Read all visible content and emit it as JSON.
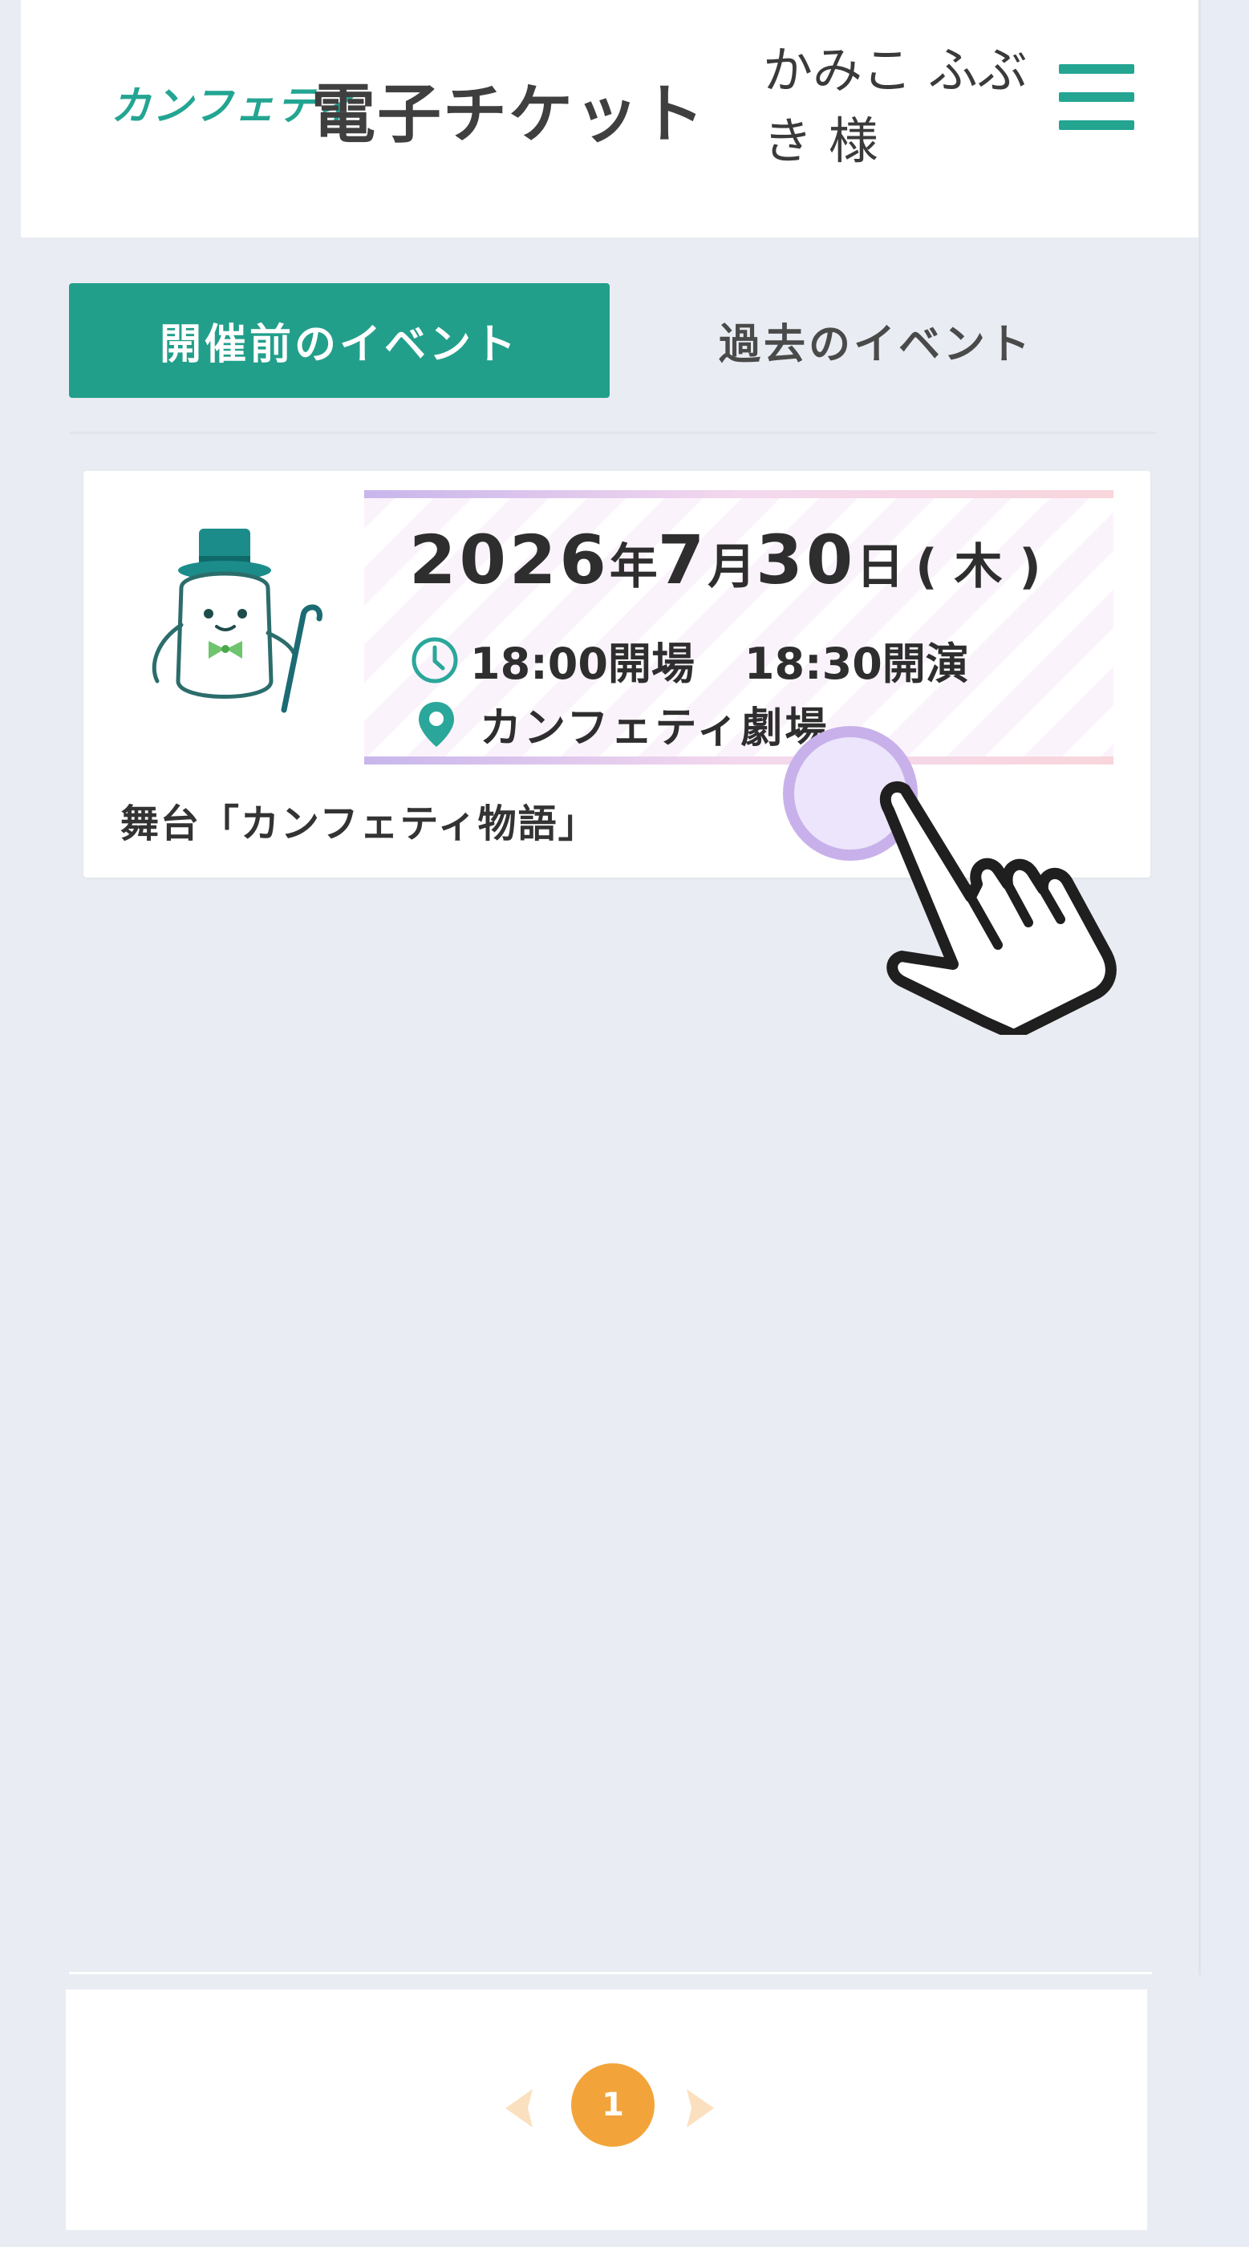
{
  "header": {
    "brand_small": "カンフェティ",
    "brand_title": "電子チケット",
    "user_name": "かみこ ふぶき 様"
  },
  "tabs": [
    {
      "label": "開催前のイベント",
      "active": true
    },
    {
      "label": "過去のイベント",
      "active": false
    }
  ],
  "event": {
    "date": {
      "year": "2026",
      "year_unit": "年",
      "month": "7",
      "month_unit": "月",
      "day": "30",
      "day_unit": "日",
      "weekday": "( 木 )"
    },
    "open_time": "18:00開場",
    "start_time": "18:30開演",
    "venue": "カンフェティ劇場",
    "title": "舞台「カンフェティ物語」"
  },
  "pagination": {
    "current_page": "1"
  },
  "colors": {
    "accent": "#229f8b",
    "page_active": "#f2a43a",
    "pointer_circle": "#c8b1ea"
  },
  "icons": [
    "menu-icon",
    "clock-icon",
    "location-pin-icon",
    "mascot-icon",
    "hand-pointer-icon",
    "chevron-left-icon",
    "chevron-right-icon"
  ]
}
